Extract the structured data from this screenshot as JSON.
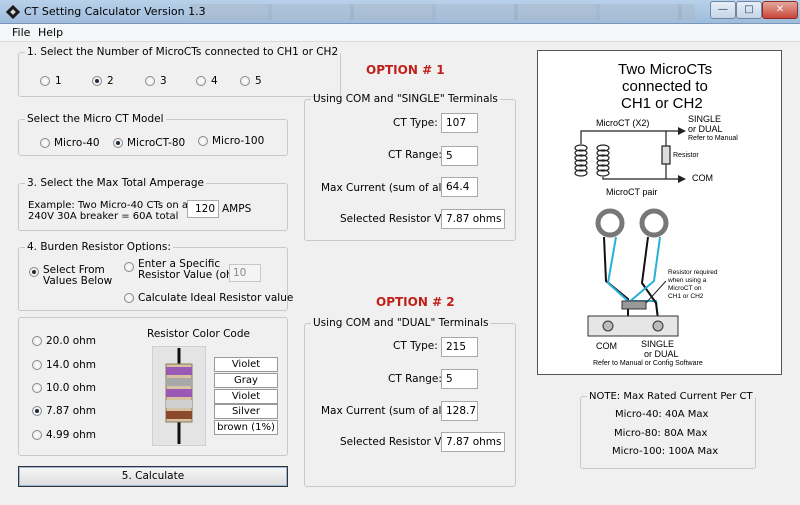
{
  "window": {
    "title": "CT Setting Calculator  Version 1.3",
    "minimize_glyph": "—",
    "maximize_glyph": "□",
    "close_glyph": "✕"
  },
  "menu": {
    "items": [
      "File",
      "Help"
    ]
  },
  "section1": {
    "legend": "1. Select the Number of MicroCTs connected to CH1 or CH2",
    "options": [
      "1",
      "2",
      "3",
      "4",
      "5"
    ],
    "selected": "2"
  },
  "model": {
    "legend": "Select the Micro CT Model",
    "options": [
      "Micro-40",
      "MicroCT-80",
      "Micro-100"
    ],
    "selected": "MicroCT-80"
  },
  "amperage": {
    "legend": "3. Select the Max Total Amperage",
    "example_line1": "Example: Two Micro-40 CTs on a",
    "example_line2": "240V 30A breaker = 60A total",
    "value": "120",
    "unit": "AMPS"
  },
  "burden": {
    "legend": "4. Burden Resistor Options:",
    "select_from_line1": "Select From",
    "select_from_line2": "Values Below",
    "specific_line1": "Enter a Specific",
    "specific_line2": "Resistor Value (ohms):",
    "specific_value": "10",
    "ideal": "Calculate Ideal Resistor value"
  },
  "resistor_values": {
    "options": [
      "20.0 ohm",
      "14.0 ohm",
      "10.0 ohm",
      "7.87 ohm",
      "4.99 ohm"
    ],
    "selected": "7.87 ohm"
  },
  "color_code": {
    "title": "Resistor Color Code",
    "bands": [
      "Violet",
      "Gray",
      "Violet",
      "Silver",
      "brown (1%)"
    ],
    "band_colors": [
      "#9b59b6",
      "#a8a8a8",
      "#9b59b6",
      "#cfcfcf",
      "#8b4a2b"
    ]
  },
  "calculate_button": "5. Calculate",
  "option1": {
    "title": "OPTION # 1",
    "legend": "Using COM and \"SINGLE\" Terminals",
    "ct_type_label": "CT Type:",
    "ct_type": "107",
    "ct_range_label": "CT Range:",
    "ct_range": "5",
    "max_current_label": "Max Current (sum of all CTs):",
    "max_current": "64.4",
    "resistor_label": "Selected Resistor Value",
    "resistor": "7.87 ohms"
  },
  "option2": {
    "title": "OPTION # 2",
    "legend": "Using COM and \"DUAL\" Terminals",
    "ct_type_label": "CT Type:",
    "ct_type": "215",
    "ct_range_label": "CT Range:",
    "ct_range": "5",
    "max_current_label": "Max Current (sum of all CTs):",
    "max_current": "128.7",
    "resistor_label": "Selected Resistor Value",
    "resistor": "7.87 ohms"
  },
  "diagram": {
    "title_line1": "Two MicroCTs",
    "title_line2": "connected to",
    "title_line3": "CH1 or CH2",
    "microct_label": "MicroCT (X2)",
    "single_label": "SINGLE",
    "or_dual_label": "or DUAL",
    "refer_manual": "Refer to Manual",
    "resistor_label": "Resistor",
    "com_arrow_label": "COM",
    "pair_label": "MicroCT pair",
    "note_line1": "Resistor required",
    "note_line2": "when using a",
    "note_line3": "MicroCT on",
    "note_line4": "CH1 or CH2",
    "com_terminal": "COM",
    "single_terminal": "SINGLE",
    "or_dual_terminal": "or DUAL",
    "refer_software": "Refer to Manual or Config Software"
  },
  "note": {
    "legend": "NOTE: Max Rated Current Per CT",
    "lines": [
      "Micro-40:  40A Max",
      "Micro-80:  80A Max",
      "Micro-100: 100A Max"
    ]
  }
}
